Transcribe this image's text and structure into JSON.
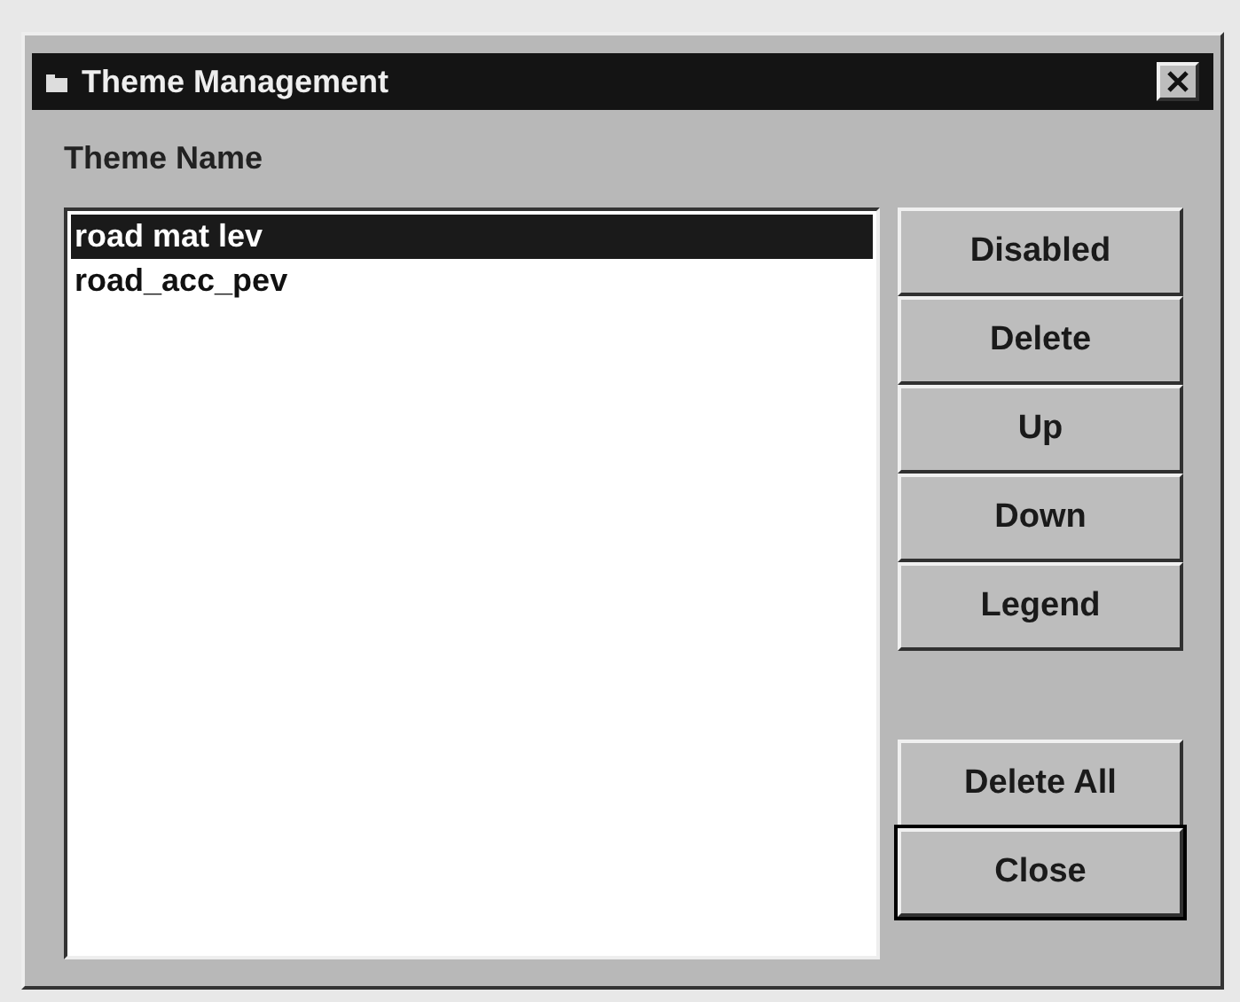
{
  "window": {
    "title": "Theme Management"
  },
  "theme_name_label": "Theme Name",
  "themes": [
    {
      "name": "road mat lev",
      "selected": true
    },
    {
      "name": "road_acc_pev",
      "selected": false
    }
  ],
  "buttons": [
    {
      "label": "Disabled",
      "default": false
    },
    {
      "label": "Delete",
      "default": false
    },
    {
      "label": "Up",
      "default": false
    },
    {
      "label": "Down",
      "default": false
    },
    {
      "label": "Legend",
      "default": false
    }
  ],
  "bottom_buttons": [
    {
      "label": "Delete All",
      "default": false
    },
    {
      "label": "Close",
      "default": true
    }
  ]
}
